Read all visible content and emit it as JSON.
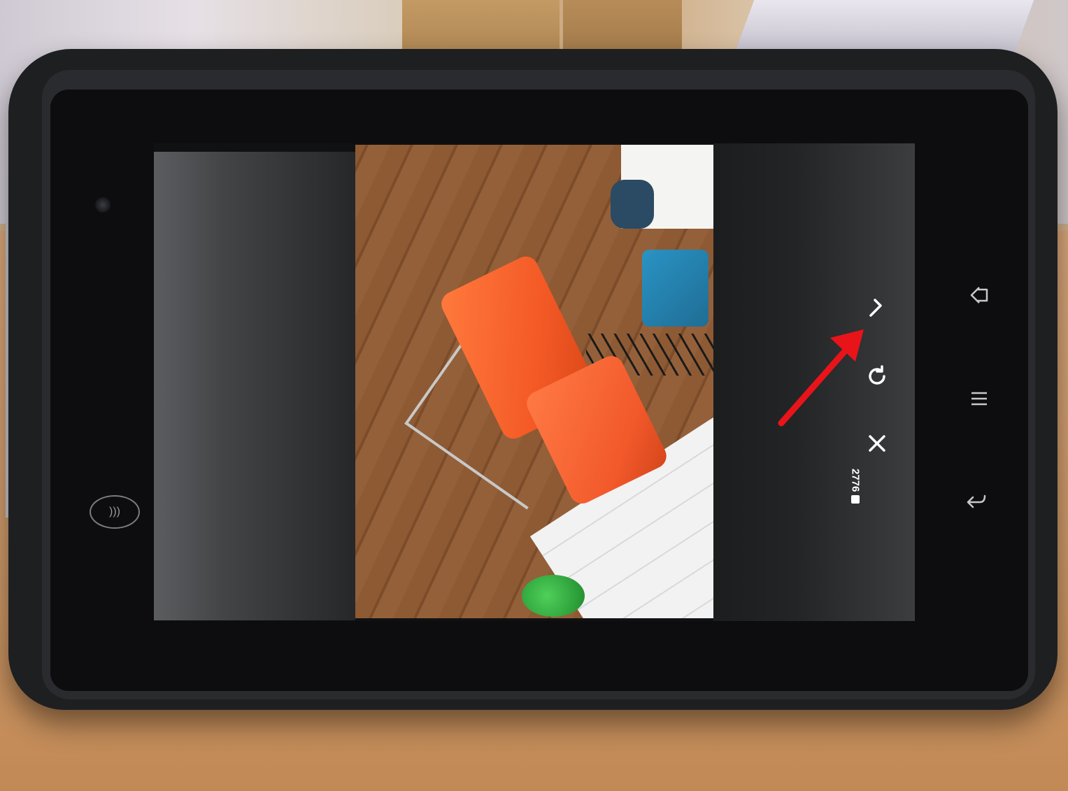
{
  "camera_preview": {
    "storage_count": "2776",
    "controls": [
      {
        "name": "confirm",
        "icon": "check-icon"
      },
      {
        "name": "retake",
        "icon": "rotate-icon"
      },
      {
        "name": "cancel",
        "icon": "close-icon"
      }
    ]
  },
  "device_nav": {
    "buttons": [
      {
        "name": "home",
        "icon": "home-icon"
      },
      {
        "name": "menu",
        "icon": "menu-icon"
      },
      {
        "name": "back",
        "icon": "back-icon"
      }
    ]
  },
  "annotation": {
    "color": "#e8141a",
    "target": "check-icon"
  },
  "colors": {
    "tablet_body": "#1e1f21",
    "chair": "#f45a26",
    "control_fg": "#ffffff"
  }
}
